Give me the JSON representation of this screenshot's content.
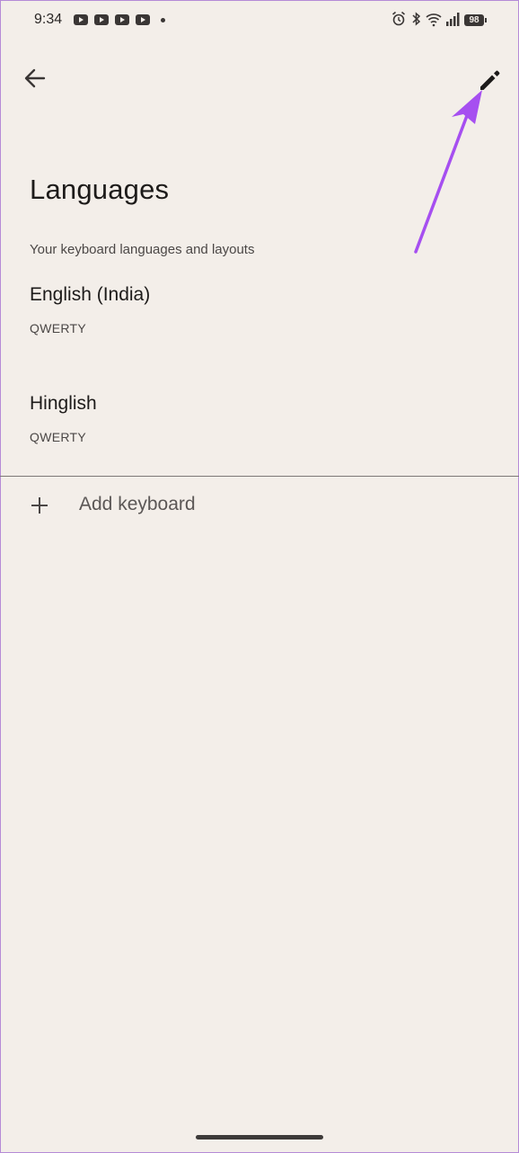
{
  "status_bar": {
    "time": "9:34",
    "battery": "98",
    "notification_icons": [
      "youtube-icon",
      "youtube-icon",
      "youtube-icon",
      "youtube-icon"
    ],
    "system_icons": [
      "alarm-icon",
      "bluetooth-icon",
      "wifi-icon",
      "signal-icon",
      "battery-icon"
    ]
  },
  "header": {
    "back_icon": "arrow-left-icon",
    "edit_icon": "pencil-icon"
  },
  "page": {
    "title": "Languages",
    "subtitle": "Your keyboard languages and layouts"
  },
  "languages": [
    {
      "name": "English (India)",
      "layout": "QWERTY"
    },
    {
      "name": "Hinglish",
      "layout": "QWERTY"
    }
  ],
  "add_keyboard": {
    "label": "Add keyboard",
    "icon": "plus-icon"
  },
  "annotation": {
    "arrow_color": "#a64ff0"
  },
  "colors": {
    "background": "#f3eee9",
    "text_primary": "#1d1b1a",
    "text_secondary": "#4b4746"
  }
}
